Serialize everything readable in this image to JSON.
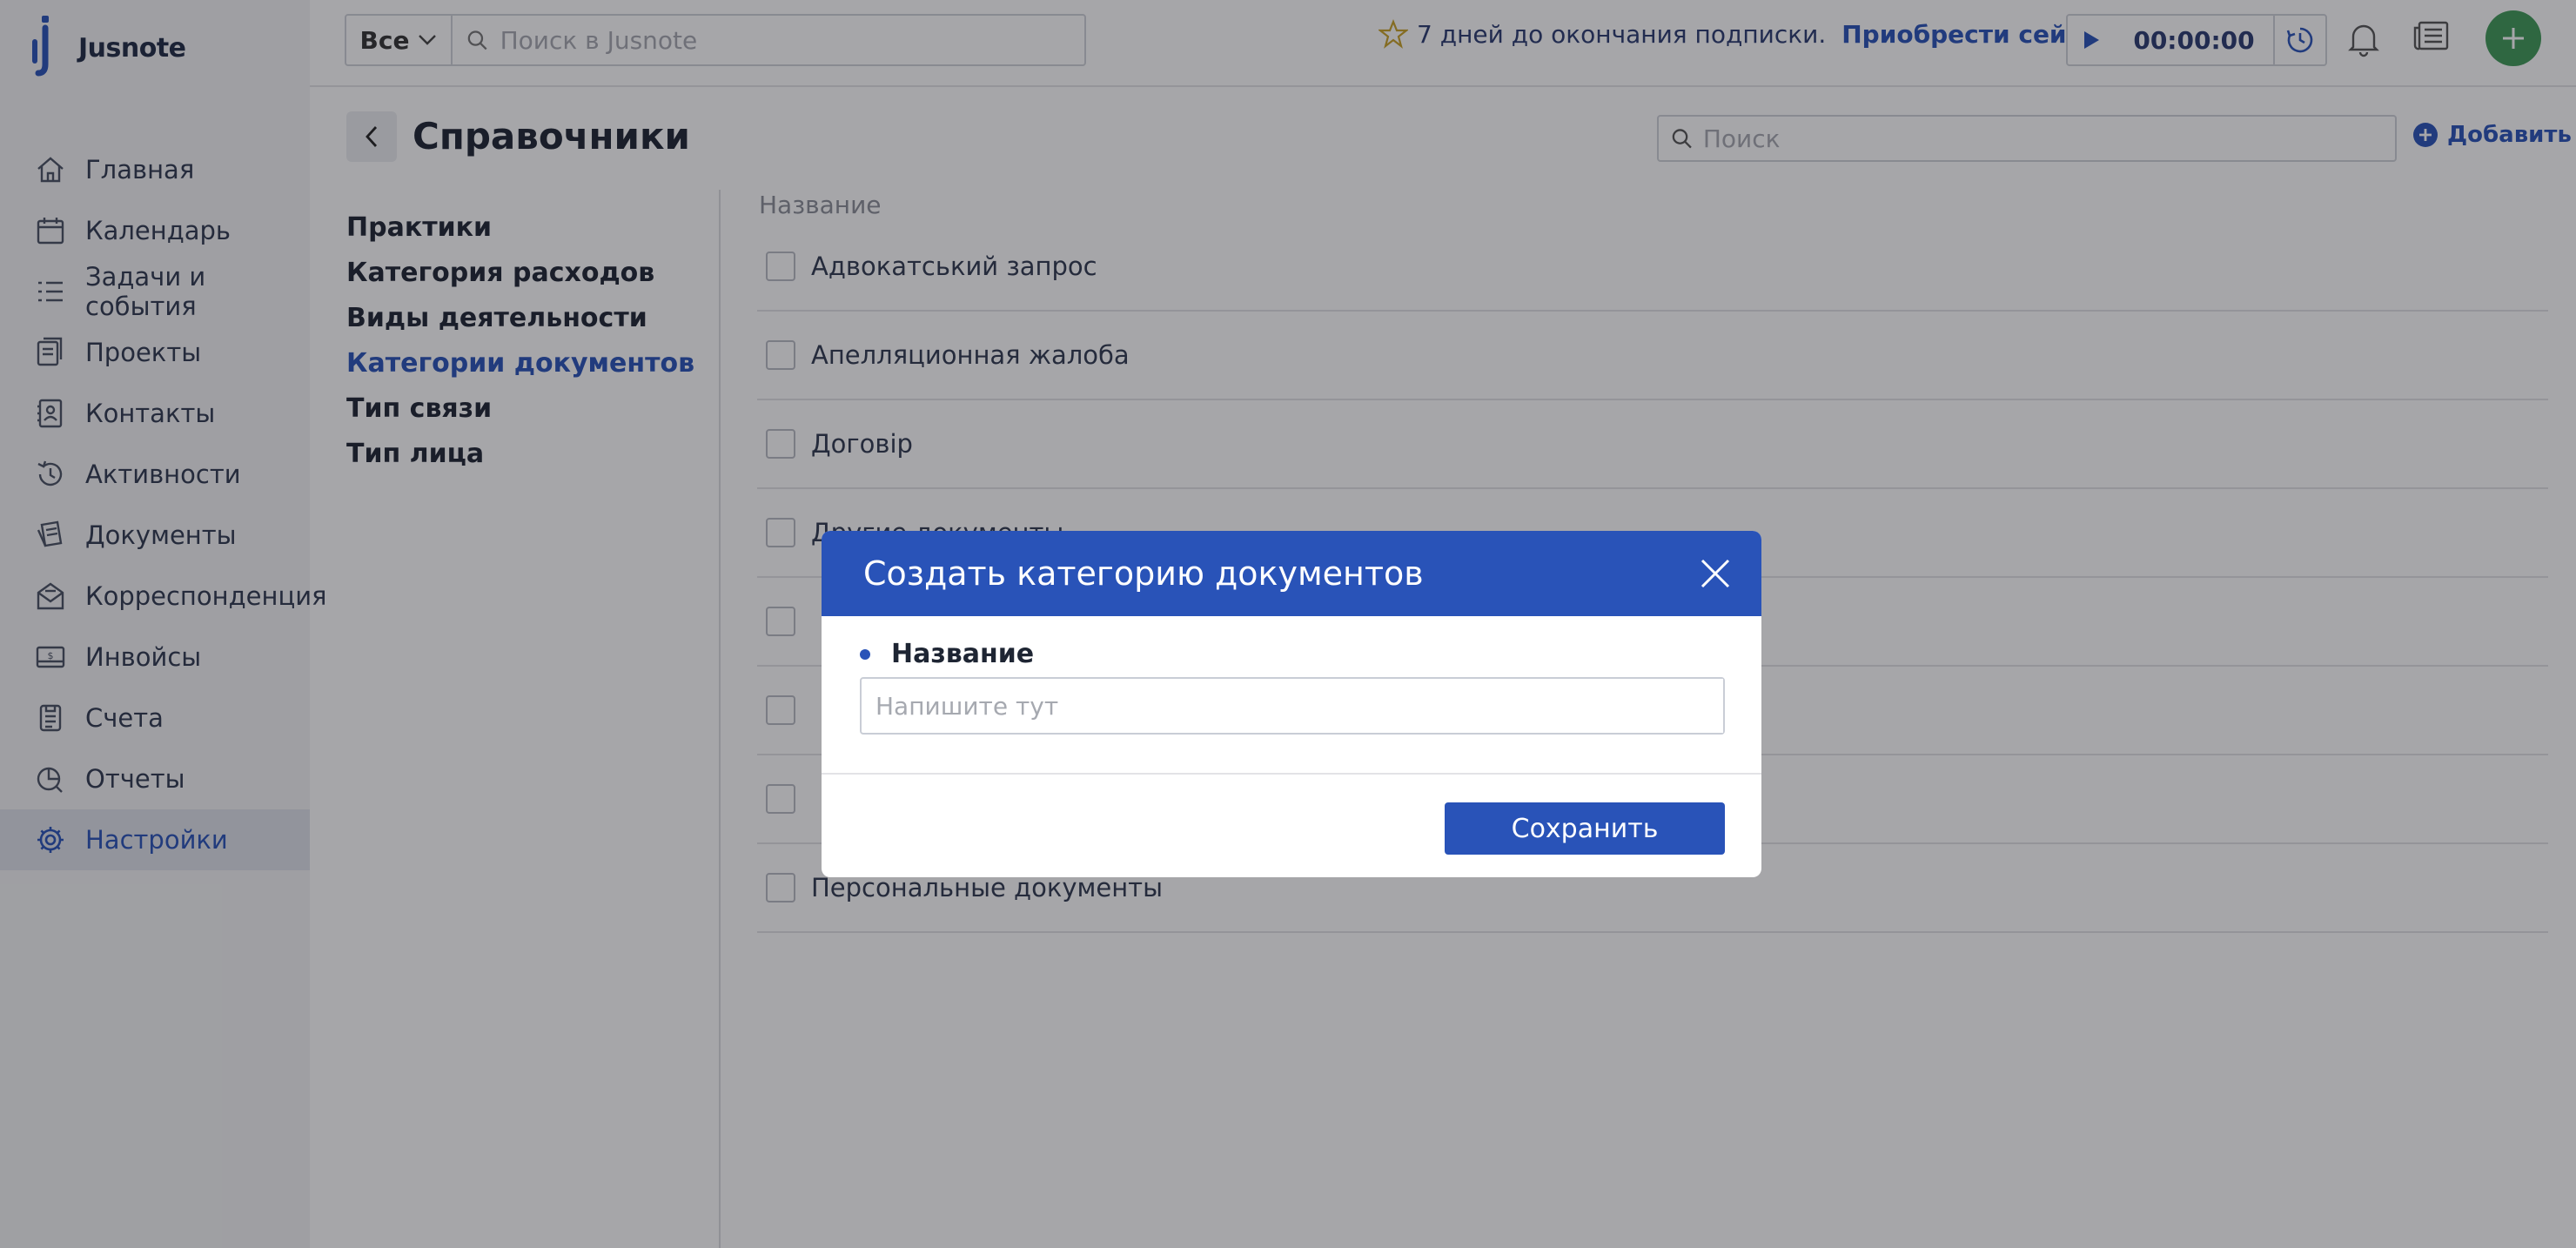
{
  "brand": {
    "name": "Jusnote"
  },
  "sidebar": {
    "items": [
      {
        "label": "Главная",
        "icon": "home-icon"
      },
      {
        "label": "Календарь",
        "icon": "calendar-icon"
      },
      {
        "label": "Задачи и события",
        "icon": "tasks-icon"
      },
      {
        "label": "Проекты",
        "icon": "projects-icon"
      },
      {
        "label": "Контакты",
        "icon": "contacts-icon"
      },
      {
        "label": "Активности",
        "icon": "activity-icon"
      },
      {
        "label": "Документы",
        "icon": "documents-icon"
      },
      {
        "label": "Корреспонденция",
        "icon": "mail-icon"
      },
      {
        "label": "Инвойсы",
        "icon": "invoice-icon"
      },
      {
        "label": "Счета",
        "icon": "accounts-icon"
      },
      {
        "label": "Отчеты",
        "icon": "reports-icon"
      },
      {
        "label": "Настройки",
        "icon": "gear-icon",
        "active": true
      }
    ]
  },
  "topbar": {
    "scope_label": "Все",
    "search_placeholder": "Поиск в Jusnote",
    "subscription_text": "7 дней до окончания подписки.",
    "subscription_link": "Приобрести сейчас",
    "timer": "00:00:00"
  },
  "page": {
    "title": "Справочники",
    "search_placeholder": "Поиск",
    "add_label": "Добавить",
    "ref_nav": [
      {
        "label": "Практики"
      },
      {
        "label": "Категория расходов"
      },
      {
        "label": "Виды деятельности"
      },
      {
        "label": "Категории документов",
        "active": true
      },
      {
        "label": "Тип связи"
      },
      {
        "label": "Тип лица"
      }
    ],
    "column_header": "Название",
    "rows": [
      "Адвокатський запрос",
      "Апелляционная жалоба",
      "Договір",
      "Другие документы",
      "",
      "",
      "",
      "Персональные документы"
    ]
  },
  "modal": {
    "title": "Создать категорию документов",
    "field_label": "Название",
    "field_placeholder": "Напишите тут",
    "field_value": "",
    "save_label": "Сохранить"
  },
  "colors": {
    "accent": "#2953b8",
    "fab": "#3f9a58"
  }
}
